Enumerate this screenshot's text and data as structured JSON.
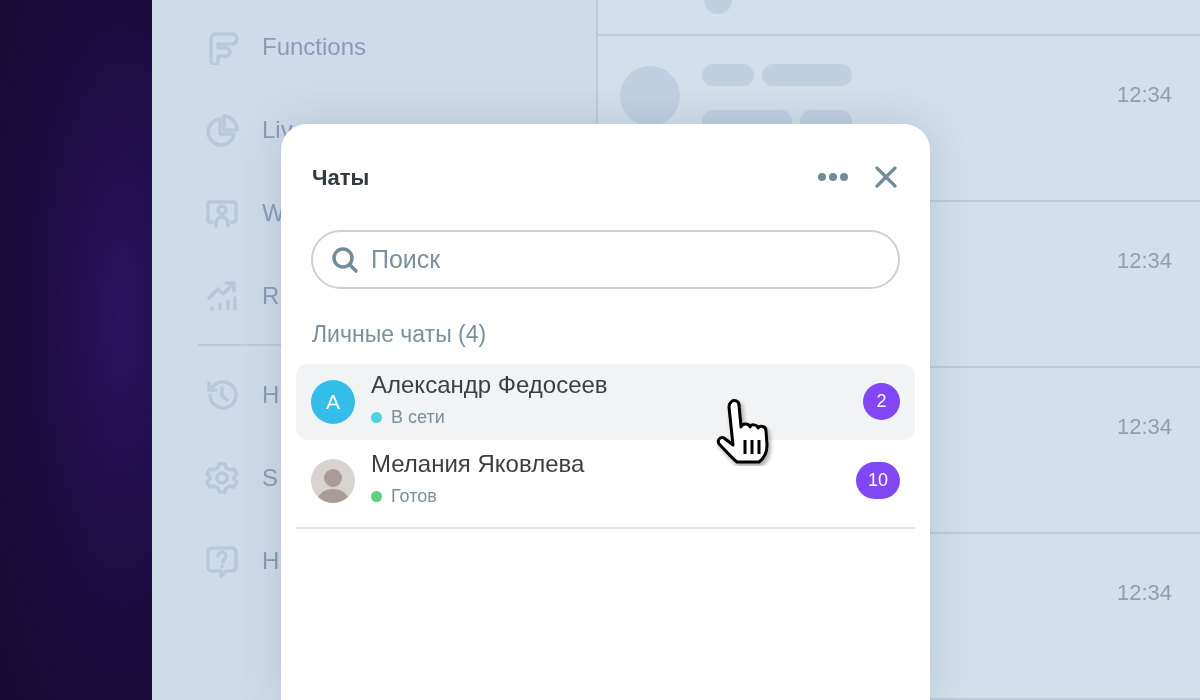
{
  "background_app": {
    "sidebar": {
      "groups": [
        {
          "items": [
            {
              "label": "Functions"
            },
            {
              "label": "Liv"
            },
            {
              "label": "W"
            },
            {
              "label": "R"
            }
          ]
        },
        {
          "items": [
            {
              "label": "H"
            },
            {
              "label": "S"
            },
            {
              "label": "H"
            }
          ]
        }
      ]
    },
    "conversations": [
      {
        "time": "12:34"
      },
      {
        "time": "12:34"
      },
      {
        "time": "12:34"
      },
      {
        "time": "12:34"
      }
    ]
  },
  "chat_popup": {
    "title": "Чаты",
    "search": {
      "placeholder": "Поиск"
    },
    "section": "Личные чаты (4)",
    "chats": [
      {
        "name": "Александр Федосеев",
        "status": "В сети",
        "color": "#4dd4e0",
        "unread": "2",
        "hovered": true,
        "avatar": {
          "kind": "letter",
          "initial": "А"
        }
      },
      {
        "name": "Мелания Яковлева",
        "status": "Готов",
        "color": "#5fcf80",
        "unread": "10",
        "hovered": false,
        "avatar": {
          "kind": "photo"
        }
      }
    ]
  }
}
